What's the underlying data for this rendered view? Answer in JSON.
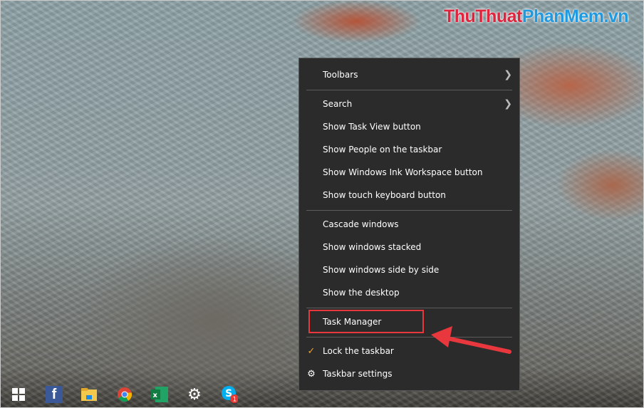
{
  "watermark": {
    "part1": "ThuThuat",
    "part2": "PhanMem.vn"
  },
  "menu": {
    "toolbars": "Toolbars",
    "search": "Search",
    "task_view": "Show Task View button",
    "people": "Show People on the taskbar",
    "ink": "Show Windows Ink Workspace button",
    "touch_keyboard": "Show touch keyboard button",
    "cascade": "Cascade windows",
    "stacked": "Show windows stacked",
    "side_by_side": "Show windows side by side",
    "desktop": "Show the desktop",
    "task_manager": "Task Manager",
    "lock": "Lock the taskbar",
    "settings": "Taskbar settings"
  },
  "taskbar": {
    "skype_badge": "1"
  },
  "colors": {
    "highlight": "#e8383d",
    "menu_bg": "#2b2b2b"
  }
}
